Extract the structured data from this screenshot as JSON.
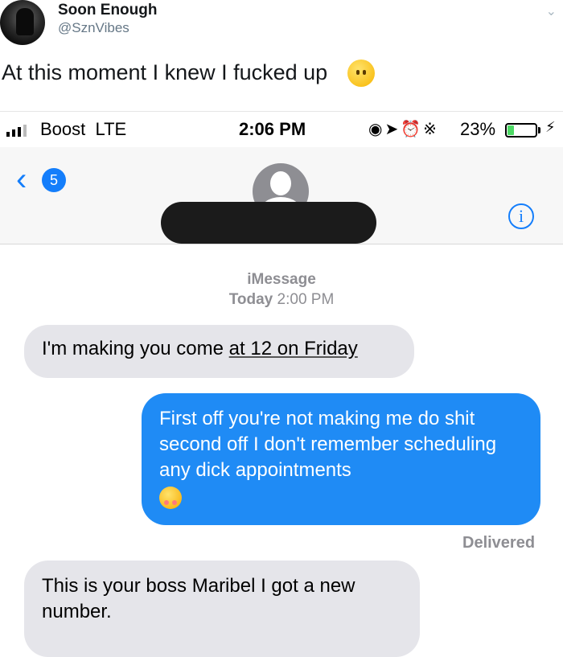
{
  "tweet": {
    "display_name": "Soon Enough",
    "handle": "@SznVibes",
    "text": "At this moment I knew I fucked up"
  },
  "phone": {
    "status_bar": {
      "carrier": "Boost",
      "network": "LTE",
      "time": "2:06 PM",
      "battery_percent": "23%",
      "battery_level": 0.23
    },
    "nav": {
      "back_count": "5",
      "info_label": "i"
    },
    "conversation": {
      "service": "iMessage",
      "timestamp_day": "Today",
      "timestamp_time": "2:00 PM",
      "messages": [
        {
          "direction": "incoming",
          "text_before": "I'm making you come ",
          "text_link": "at 12 on Friday"
        },
        {
          "direction": "outgoing",
          "text": "First off you're not making me do shit second off I don't remember scheduling any dick appointments",
          "emoji": "pensive-face"
        },
        {
          "direction": "incoming",
          "text": "This is your boss Maribel I got a new number."
        }
      ],
      "delivered_label": "Delivered"
    }
  }
}
